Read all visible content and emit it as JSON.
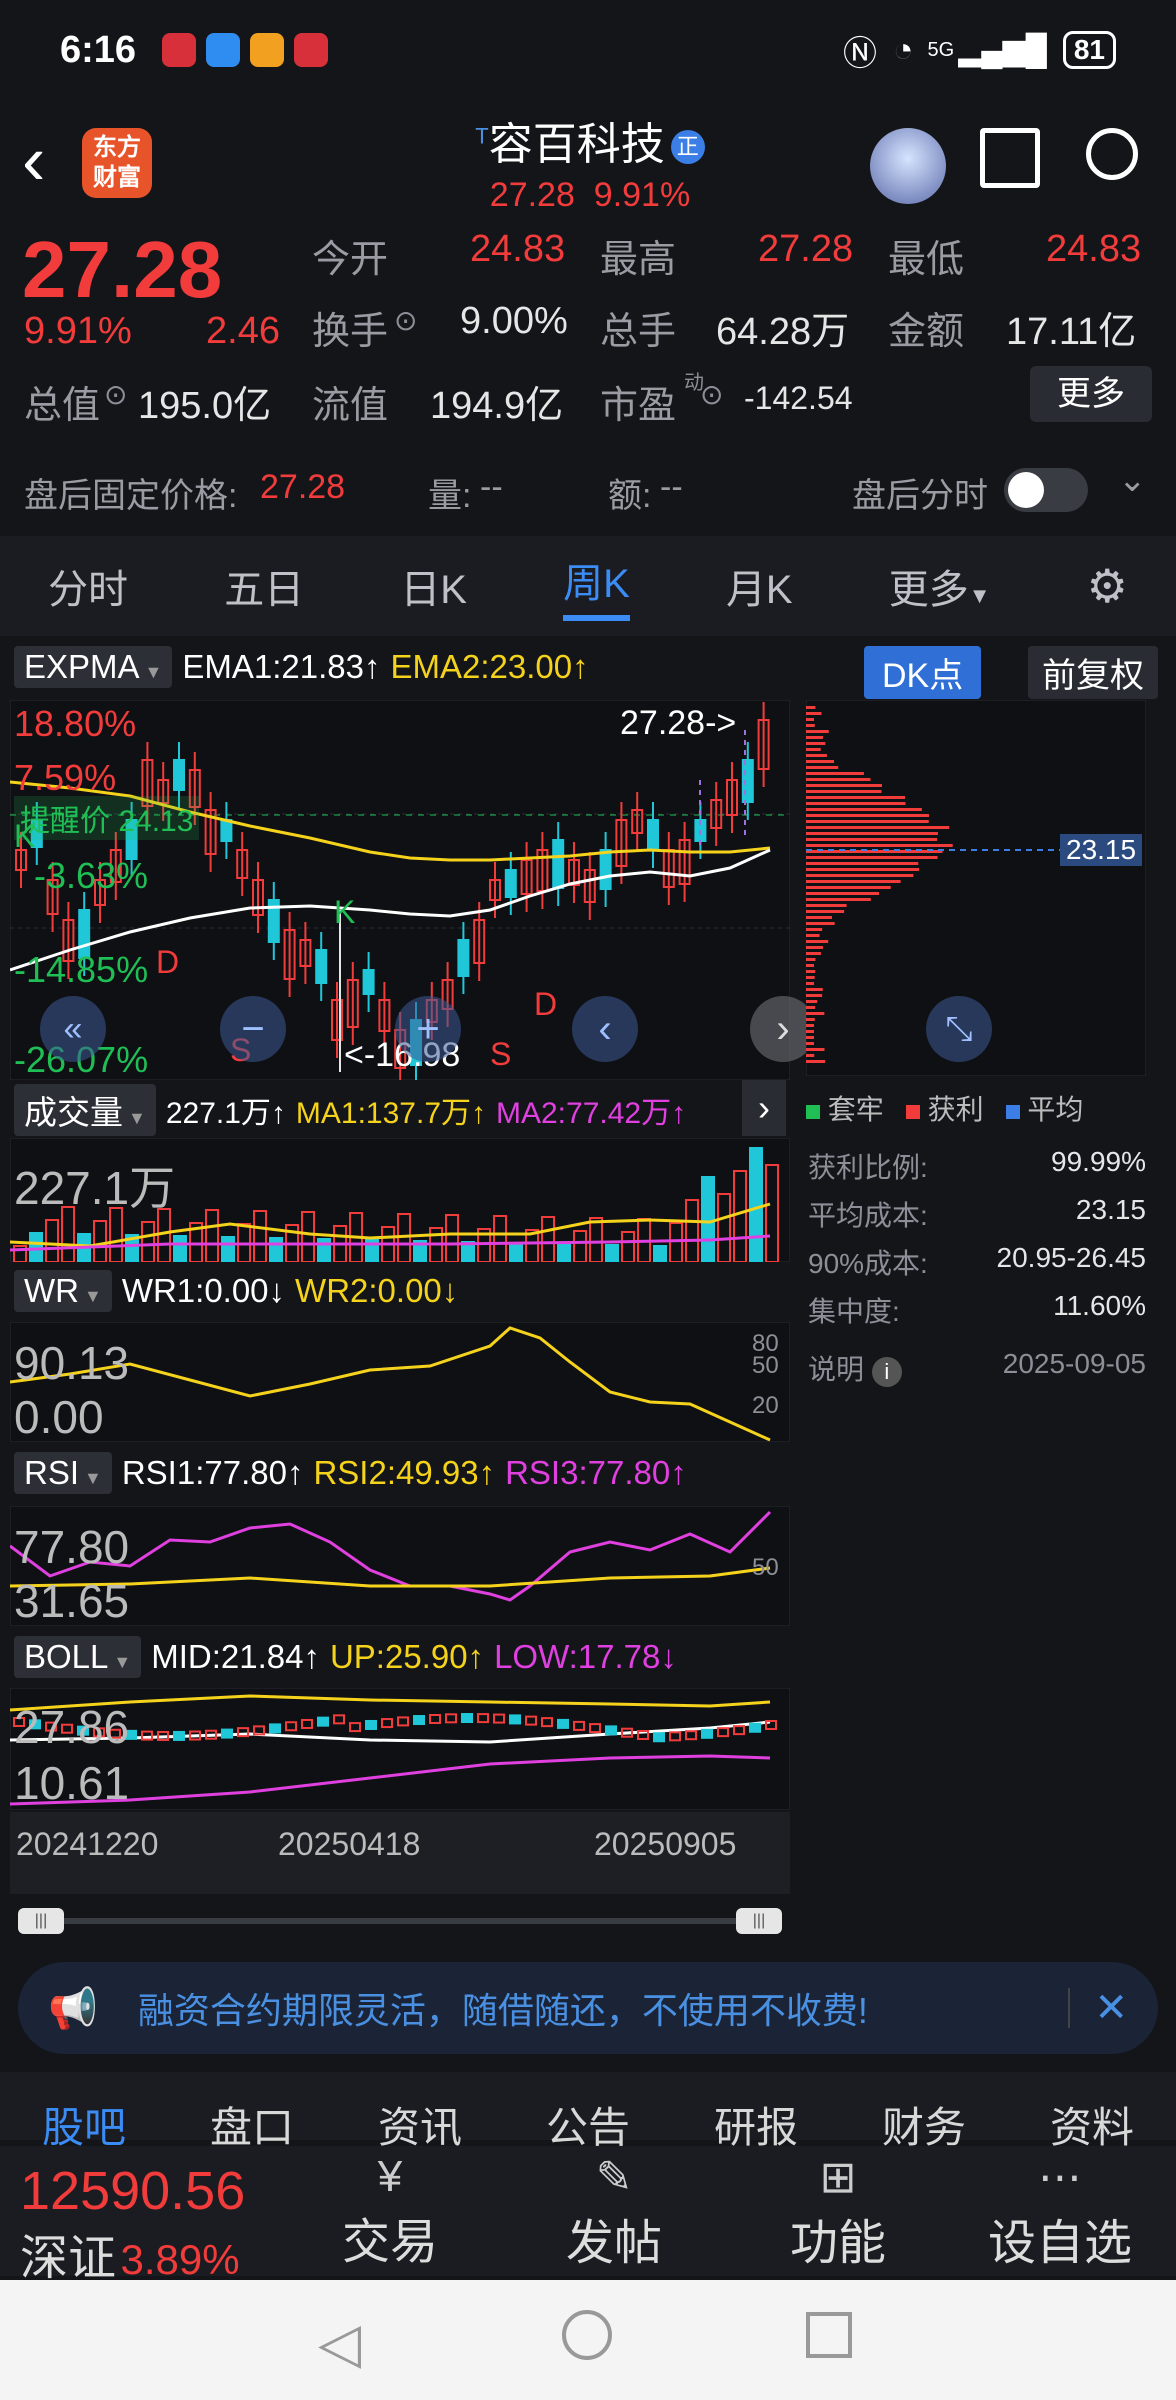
{
  "status": {
    "time": "6:16",
    "battery": "81",
    "net": "5G"
  },
  "header": {
    "app": "东方\n财富",
    "title": "容百科技",
    "title_mark": "T",
    "badge": "正",
    "price": "27.28",
    "pct": "9.91%"
  },
  "quote": {
    "price": "27.28",
    "pct": "9.91%",
    "change": "2.46",
    "open_l": "今开",
    "open": "24.83",
    "high_l": "最高",
    "high": "27.28",
    "low_l": "最低",
    "low": "24.83",
    "turn_l": "换手",
    "turn": "9.00%",
    "vol_l": "总手",
    "vol": "64.28万",
    "amt_l": "金额",
    "amt": "17.11亿",
    "mcap_l": "总值",
    "mcap": "195.0亿",
    "float_l": "流值",
    "float": "194.9亿",
    "pe_l": "市盈",
    "pe_sup": "动",
    "pe": "-142.54",
    "more": "更多"
  },
  "after": {
    "label": "盘后固定价格:",
    "price": "27.28",
    "vol_l": "量:",
    "vol": "--",
    "amt_l": "额:",
    "amt": "--",
    "switch_l": "盘后分时"
  },
  "tabs": [
    "分时",
    "五日",
    "日K",
    "周K",
    "月K",
    "更多"
  ],
  "active_tab": "周K",
  "kchart": {
    "ind": "EXPMA",
    "ema1": "EMA1:21.83↑",
    "ema2": "EMA2:23.00↑",
    "dk": "DK点",
    "fq": "前复权",
    "pcts": [
      "18.80%",
      "7.59%",
      "-3.63%",
      "-14.85%",
      "-26.07%"
    ],
    "alert": "提醒价 24.13",
    "high_tag": "27.28->",
    "low_tag": "<-16.98",
    "sig": [
      "K",
      "K",
      "D",
      "S",
      "S",
      "D"
    ],
    "nav_icons": [
      "double-left-icon",
      "minus-icon",
      "plus-icon",
      "left-icon",
      "right-icon"
    ]
  },
  "chip": {
    "legend": [
      "套牢",
      "获利",
      "平均"
    ],
    "avg_tag": "23.15",
    "rows": [
      {
        "k": "获利比例:",
        "v": "99.99%"
      },
      {
        "k": "平均成本:",
        "v": "23.15"
      },
      {
        "k": "90%成本:",
        "v": "20.95-26.45"
      },
      {
        "k": "集中度:",
        "v": "11.60%"
      }
    ],
    "note": "说明",
    "date": "2025-09-05"
  },
  "volume": {
    "ind": "成交量",
    "v": "227.1万↑",
    "ma1": "MA1:137.7万↑",
    "ma2": "MA2:77.42万↑",
    "max": "227.1万"
  },
  "wr": {
    "ind": "WR",
    "wr1": "WR1:0.00↓",
    "wr2": "WR2:0.00↓",
    "top": "90.13",
    "bot": "0.00",
    "levels": [
      "80",
      "50",
      "20"
    ]
  },
  "rsi": {
    "ind": "RSI",
    "r1": "RSI1:77.80↑",
    "r2": "RSI2:49.93↑",
    "r3": "RSI3:77.80↑",
    "top": "77.80",
    "bot": "31.65",
    "mid": "50"
  },
  "boll": {
    "ind": "BOLL",
    "mid": "MID:21.84↑",
    "up": "UP:25.90↑",
    "low": "LOW:17.78↓",
    "top": "27.86",
    "bot": "10.61"
  },
  "dates": [
    "20241220",
    "20250418",
    "20250905"
  ],
  "banner": {
    "text": "融资合约期限灵活，随借随还，不使用不收费!"
  },
  "subtabs": [
    "股吧",
    "盘口",
    "资讯",
    "公告",
    "研报",
    "财务",
    "资料"
  ],
  "index": {
    "value": "12590.56",
    "name": "深证",
    "pct": "3.89%"
  },
  "bottom": [
    {
      "icon": "yen-cycle-icon",
      "label": "交易"
    },
    {
      "icon": "edit-icon",
      "label": "发帖"
    },
    {
      "icon": "grid-icon",
      "label": "功能"
    },
    {
      "icon": "more-circle-icon",
      "label": "设自选"
    }
  ]
}
